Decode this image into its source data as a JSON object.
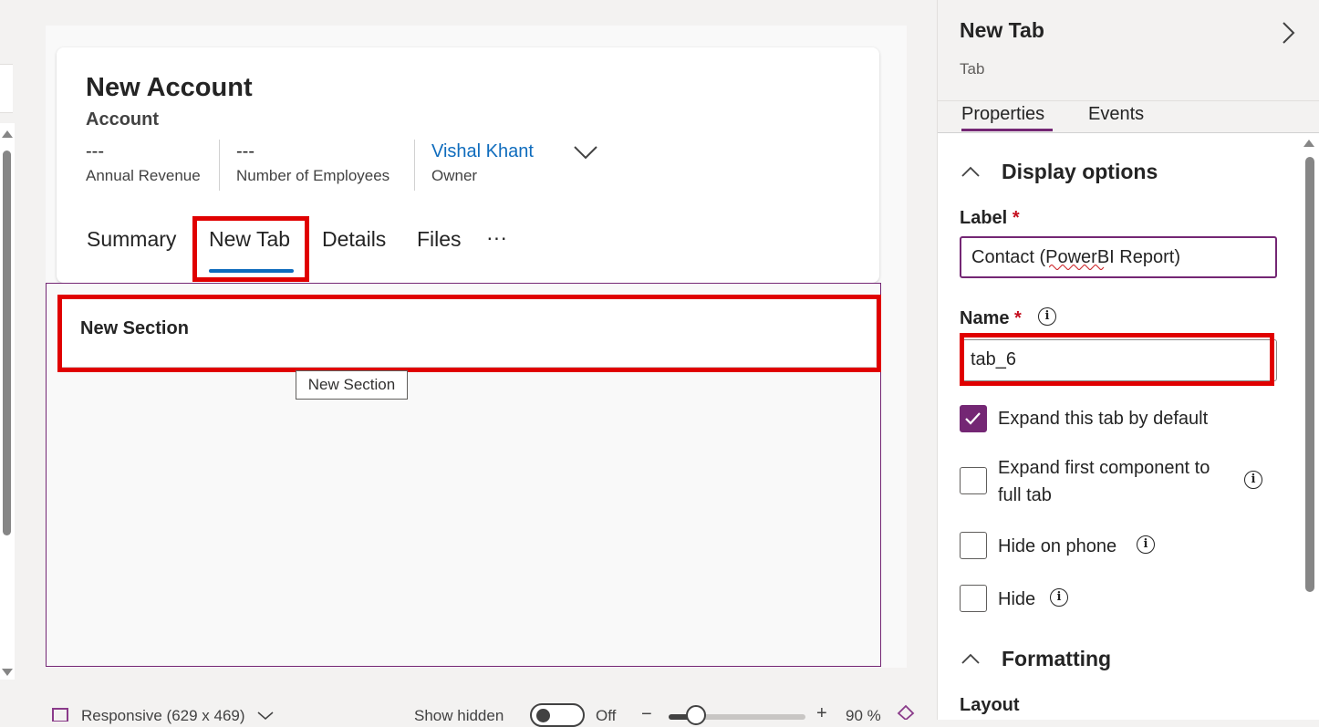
{
  "form": {
    "title": "New Account",
    "entity": "Account",
    "header_fields": [
      {
        "value": "---",
        "label": "Annual Revenue"
      },
      {
        "value": "---",
        "label": "Number of Employees"
      },
      {
        "value": "Vishal Khant",
        "label": "Owner"
      }
    ],
    "tabs": [
      "Summary",
      "New Tab",
      "Details",
      "Files"
    ],
    "more_tabs": "···",
    "active_tab": "New Tab",
    "section_title": "New Section",
    "section_tooltip": "New Section"
  },
  "bottom_bar": {
    "responsive_label": "Responsive (629 x 469)",
    "show_hidden_label": "Show hidden",
    "toggle_state": "Off",
    "zoom_minus": "−",
    "zoom_plus": "+",
    "zoom": "90 %",
    "zoom_level_fraction": 0.2
  },
  "panel": {
    "title": "New Tab",
    "subtitle": "Tab",
    "tabs": [
      "Properties",
      "Events"
    ],
    "active_tab": "Properties",
    "display_options_heading": "Display options",
    "label_field": {
      "label": "Label",
      "required_mark": "*",
      "value": "Contact (PowerBI Report)"
    },
    "name_field": {
      "label": "Name",
      "required_mark": "*",
      "value": "tab_6"
    },
    "checkboxes": [
      {
        "label_line1": "Expand this tab by default",
        "label_line2": "",
        "checked": true,
        "info": false
      },
      {
        "label_line1": "Expand first component to",
        "label_line2": "full tab",
        "checked": false,
        "info": true
      },
      {
        "label_line1": "Hide on phone",
        "label_line2": "",
        "checked": false,
        "info": true
      },
      {
        "label_line1": "Hide",
        "label_line2": "",
        "checked": false,
        "info": true
      }
    ],
    "formatting_heading": "Formatting",
    "layout_label": "Layout"
  },
  "colors": {
    "accent": "#742774",
    "link": "#0f6cbd",
    "highlight_box": "#e00000",
    "required": "#c50f1f"
  },
  "icons": {
    "collapse_panel": "chevron-right-icon",
    "owner_expand": "chevron-down-icon",
    "section_collapse": "chevron-up-icon",
    "info": "info-icon",
    "check": "checkmark-icon",
    "responsive": "device-icon"
  }
}
